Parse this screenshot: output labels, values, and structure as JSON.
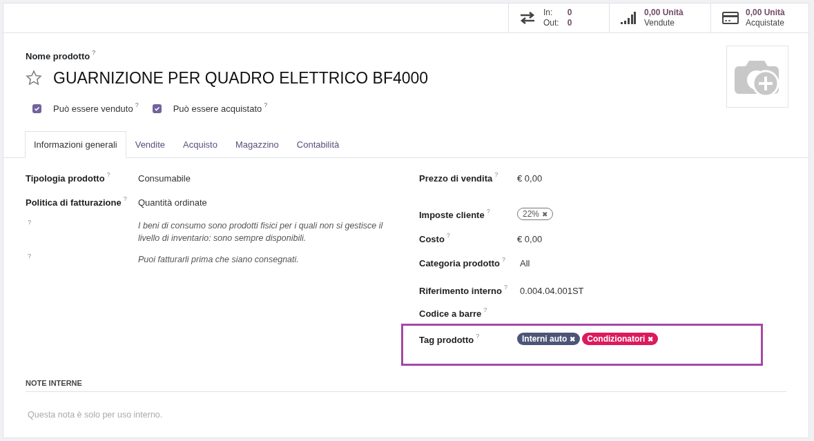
{
  "stat_buttons": [
    {
      "kind": "inout",
      "in_label": "In:",
      "in_value": "0",
      "out_label": "Out:",
      "out_value": "0"
    },
    {
      "kind": "sold",
      "value": "0,00 Unità",
      "label": "Vendute"
    },
    {
      "kind": "purchased",
      "value": "0,00 Unità",
      "label": "Acquistate"
    }
  ],
  "product": {
    "name_label": "Nome prodotto",
    "name_help": "?",
    "favorite": false,
    "name": "GUARNIZIONE PER QUADRO ELETTRICO BF4000"
  },
  "options": [
    {
      "label": "Può essere venduto",
      "help": "?",
      "checked": true
    },
    {
      "label": "Può essere acquistato",
      "help": "?",
      "checked": true
    }
  ],
  "tabs": [
    {
      "label": "Informazioni generali",
      "selected": true
    },
    {
      "label": "Vendite",
      "selected": false
    },
    {
      "label": "Acquisto",
      "selected": false
    },
    {
      "label": "Magazzino",
      "selected": false
    },
    {
      "label": "Contabilità",
      "selected": false
    }
  ],
  "left_fields": [
    {
      "kind": "text",
      "label": "Tipologia prodotto",
      "help": "?",
      "value": "Consumabile"
    },
    {
      "kind": "text",
      "label": "Politica di fatturazione",
      "help": "?",
      "value": "Quantità ordinate"
    },
    {
      "kind": "note",
      "help": "?",
      "value": "I beni di consumo sono prodotti fisici per i quali non si gestisce il livello di inventario: sono sempre disponibili."
    },
    {
      "kind": "note",
      "help": "?",
      "value": "Puoi fatturarli prima che siano consegnati."
    }
  ],
  "right_fields": [
    {
      "kind": "text",
      "label": "Prezzo di vendita",
      "help": "?",
      "value": "€ 0,00"
    },
    {
      "kind": "outline_tags",
      "label": "Imposte cliente",
      "help": "?",
      "tags": [
        {
          "label": "22%",
          "remove": "✖"
        }
      ]
    },
    {
      "kind": "text",
      "label": "Costo",
      "help": "?",
      "value": "€ 0,00"
    },
    {
      "kind": "text",
      "label": "Categoria prodotto",
      "help": "?",
      "value": "All"
    },
    {
      "kind": "text",
      "label": "Riferimento interno",
      "help": "?",
      "value": "0.004.04.001ST"
    },
    {
      "kind": "empty",
      "label": "Codice a barre",
      "help": "?"
    },
    {
      "kind": "color_tags",
      "label": "Tag prodotto",
      "help": "?",
      "highlighted": true,
      "tags": [
        {
          "label": "Interni auto",
          "remove": "✖",
          "color": "#4c5578"
        },
        {
          "label": "Condizionatori",
          "remove": "✖",
          "color": "#dc1a5c"
        }
      ]
    }
  ],
  "notes": {
    "title": "NOTE INTERNE",
    "placeholder": "Questa nota è solo per uso interno."
  }
}
